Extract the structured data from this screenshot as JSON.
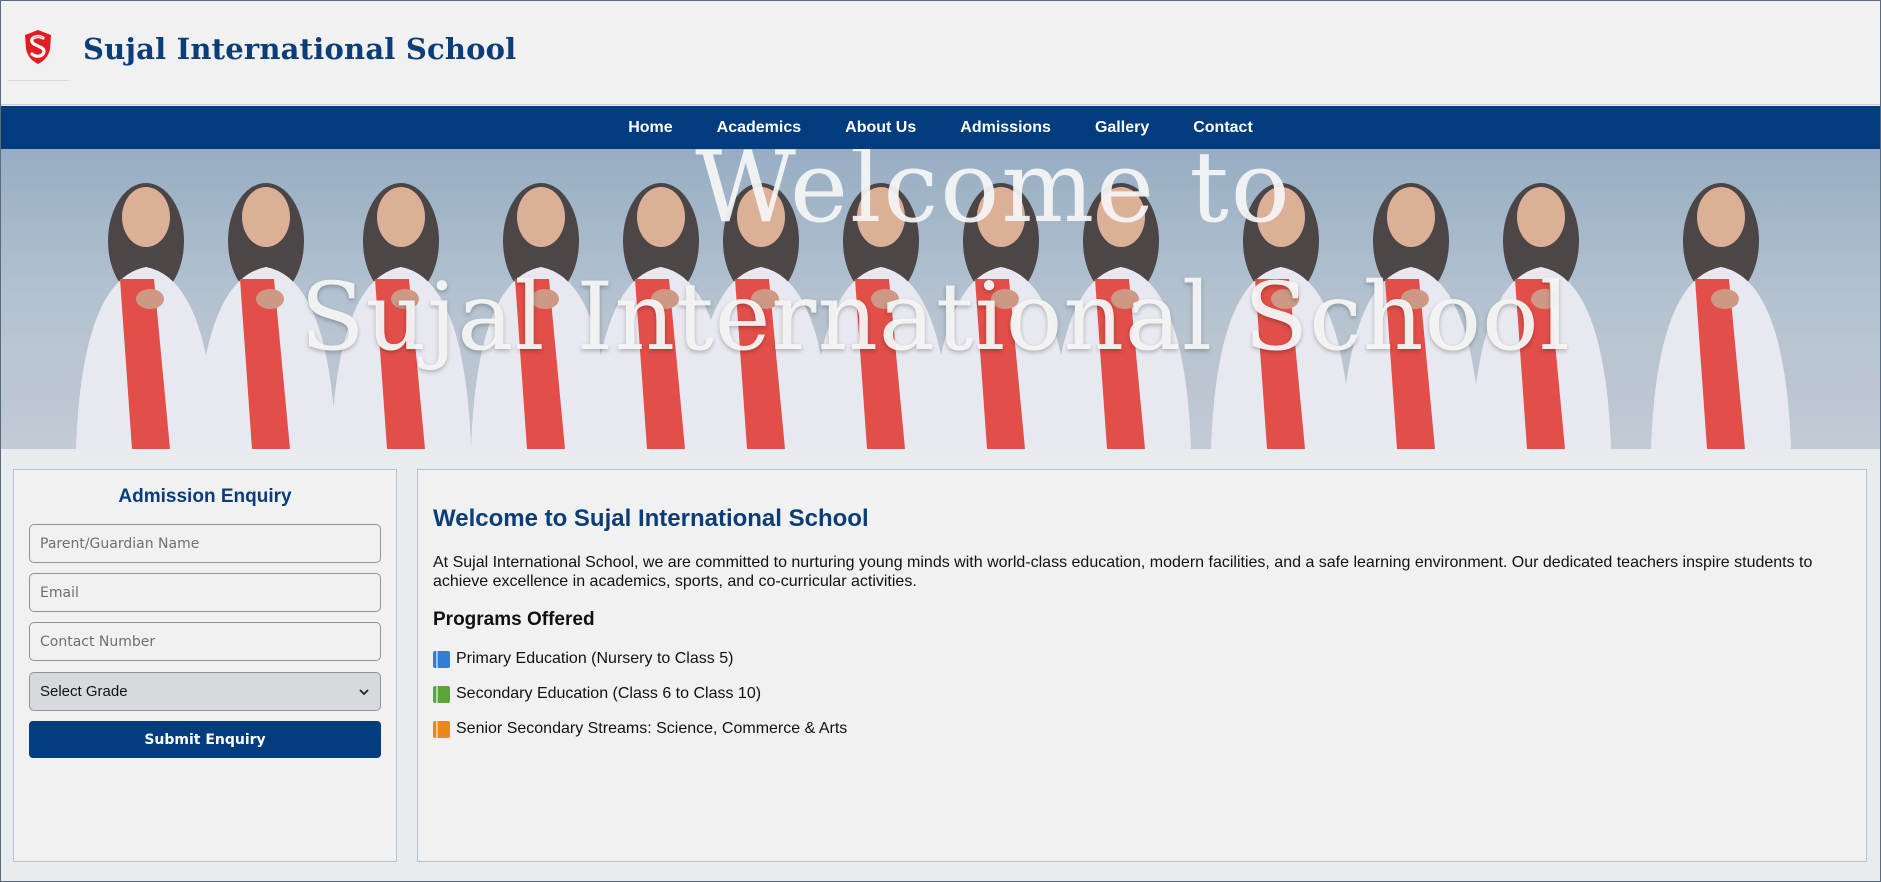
{
  "header": {
    "logo_icon": "shield-s-logo-icon",
    "title": "Sujal International School"
  },
  "nav": {
    "items": [
      "Home",
      "Academics",
      "About Us",
      "Admissions",
      "Gallery",
      "Contact"
    ]
  },
  "hero": {
    "line1": "Welcome to",
    "line2": "Sujal International School"
  },
  "enquiry": {
    "title": "Admission Enquiry",
    "name_placeholder": "Parent/Guardian Name",
    "email_placeholder": "Email",
    "contact_placeholder": "Contact Number",
    "grade_selected": "Select Grade",
    "submit_label": "Submit Enquiry"
  },
  "main": {
    "heading": "Welcome to Sujal International School",
    "intro": "At Sujal International School, we are committed to nurturing young minds with world-class education, modern facilities, and a safe learning environment. Our dedicated teachers inspire students to achieve excellence in academics, sports, and co-curricular activities.",
    "programs_heading": "Programs Offered",
    "programs": [
      {
        "icon": "blue-book-icon",
        "color": "#2f7fd6",
        "label": "Primary Education (Nursery to Class 5)"
      },
      {
        "icon": "green-book-icon",
        "color": "#5aa63c",
        "label": "Secondary Education (Class 6 to Class 10)"
      },
      {
        "icon": "orange-book-icon",
        "color": "#e8891c",
        "label": "Senior Secondary Streams: Science, Commerce & Arts"
      }
    ]
  },
  "colors": {
    "brand": "#003c7e",
    "title": "#0b3d78",
    "background": "#f1f1f1"
  }
}
